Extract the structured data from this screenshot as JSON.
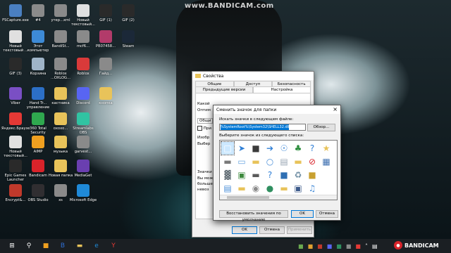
{
  "watermark": "www.BANDICAM.com",
  "desktop_icons": [
    {
      "label": "FSCapture.exe",
      "icon": "app-icon",
      "color": "#4a7fc1"
    },
    {
      "label": "#4",
      "icon": "file-icon",
      "color": "#8a8a8a"
    },
    {
      "label": "утер...xml",
      "icon": "file-icon",
      "color": "#8a8a8a"
    },
    {
      "label": "Новый текстовый...",
      "icon": "text-file-icon",
      "color": "#e0e0e0"
    },
    {
      "label": "GIF (1)",
      "icon": "image-icon",
      "color": "#2a2a2a"
    },
    {
      "label": "GIF (2)",
      "icon": "image-icon",
      "color": "#2a2a2a"
    },
    {
      "label": "Новый текстовый ...",
      "icon": "text-file-icon",
      "color": "#e0e0e0"
    },
    {
      "label": "Этот компьютер",
      "icon": "computer-icon",
      "color": "#3d8ad6"
    },
    {
      "label": "BandiSt...",
      "icon": "file-icon",
      "color": "#8a8a8a"
    },
    {
      "label": "mcf6...",
      "icon": "file-icon",
      "color": "#8a8a8a"
    },
    {
      "label": "PB07458...",
      "icon": "image-icon",
      "color": "#b23b6a"
    },
    {
      "label": "Steam",
      "icon": "steam-icon",
      "color": "#1b2838"
    },
    {
      "label": "GIF (3)",
      "icon": "image-icon",
      "color": "#2a2a2a"
    },
    {
      "label": "Корзина",
      "icon": "recycle-bin-icon",
      "color": "#9fb4c8"
    },
    {
      "label": "Roblox ...OXLOG...",
      "icon": "file-icon",
      "color": "#8a8a8a"
    },
    {
      "label": "Roblox",
      "icon": "roblox-icon",
      "color": "#d93a3a"
    },
    {
      "label": "Гайд...",
      "icon": "file-icon",
      "color": "#8a8a8a"
    },
    {
      "label": "Viber",
      "icon": "viber-icon",
      "color": "#7a4fc4"
    },
    {
      "label": "Hand Tr... управление",
      "icon": "app-icon",
      "color": "#2c6fc6"
    },
    {
      "label": "кастника",
      "icon": "folder-icon",
      "color": "#e8c35a"
    },
    {
      "label": "Discord",
      "icon": "discord-icon",
      "color": "#5865f2"
    },
    {
      "label": "кнопка",
      "icon": "folder-icon",
      "color": "#e8c35a"
    },
    {
      "label": "Яндекс.Браузер",
      "icon": "yandex-icon",
      "color": "#e53935"
    },
    {
      "label": "360 Total Security",
      "icon": "shield-icon",
      "color": "#2fa84f"
    },
    {
      "label": "охохо...",
      "icon": "folder-icon",
      "color": "#e8c35a"
    },
    {
      "label": "Streamlabs OBS",
      "icon": "obs-icon",
      "color": "#31c3a2"
    },
    {
      "label": "Новый текстовый...",
      "icon": "text-file-icon",
      "color": "#e0e0e0"
    },
    {
      "label": "AIMP",
      "icon": "aimp-icon",
      "color": "#f0a020"
    },
    {
      "label": "музыка",
      "icon": "folder-icon",
      "color": "#e8c35a"
    },
    {
      "label": "garvest...",
      "icon": "file-icon",
      "color": "#8a8a8a"
    },
    {
      "label": "Epic Games Launcher",
      "icon": "epic-icon",
      "color": "#2a2a2a"
    },
    {
      "label": "Bandicam",
      "icon": "bandicam-icon",
      "color": "#d8232a"
    },
    {
      "label": "Новая папка",
      "icon": "folder-icon",
      "color": "#e8c35a"
    },
    {
      "label": "MediaGet",
      "icon": "mediaget-icon",
      "color": "#6a3fb0"
    },
    {
      "label": "Encrypt&...",
      "icon": "app-icon",
      "color": "#c0392b"
    },
    {
      "label": "OBS Studio",
      "icon": "obs-icon",
      "color": "#302e31"
    },
    {
      "label": "xs",
      "icon": "file-icon",
      "color": "#8a8a8a"
    },
    {
      "label": "Microsoft Edge",
      "icon": "edge-icon",
      "color": "#1f8ad8"
    }
  ],
  "properties": {
    "title": "Свойства",
    "tabs_row1": [
      "Общие",
      "Доступ",
      "Безопасность"
    ],
    "tabs_row2": [
      "Предыдущие версии",
      "Настройка"
    ],
    "active_tab": "Настройка",
    "text1": "Какой",
    "text2": "Оптим",
    "text3": "Общи",
    "text4": "При",
    "text5": "Изобр",
    "text6": "Выбер",
    "text7": "Значки",
    "text8": "Вы можете",
    "text9": "больше",
    "text10": "невоз",
    "ok": "OK",
    "cancel": "Отмена",
    "apply": "Применить"
  },
  "change_icon": {
    "title": "Сменить значок для папки",
    "search_label": "Искать значки в следующем файле:",
    "path": "%SystemRoot%\\System32\\SHELL32.dll",
    "browse": "Обзор...",
    "choose_label": "Выберите значок из следующего списка:",
    "restore": "Восстановить значения по умолчанию",
    "ok": "OK",
    "cancel": "Отмена",
    "icons": [
      {
        "name": "blank-page-icon",
        "glyph": "□",
        "color": "#ffffff"
      },
      {
        "name": "drive-icon",
        "glyph": "▬",
        "color": "#7a7a7a"
      },
      {
        "name": "printer-icon",
        "glyph": "▓",
        "color": "#5f6b73"
      },
      {
        "name": "document-icon",
        "glyph": "▤",
        "color": "#4a8fd8"
      },
      {
        "name": "arrow-icon",
        "glyph": "➤",
        "color": "#2f7fd6"
      },
      {
        "name": "window-icon",
        "glyph": "▭",
        "color": "#6aa5e0"
      },
      {
        "name": "chip-icon",
        "glyph": "▣",
        "color": "#3d8a3d"
      },
      {
        "name": "folder-icon",
        "glyph": "▬",
        "color": "#e8c35a"
      },
      {
        "name": "floppy-icon",
        "glyph": "■",
        "color": "#3a3a3a"
      },
      {
        "name": "folder-search-icon",
        "glyph": "▬",
        "color": "#e8c35a"
      },
      {
        "name": "network-drive-icon",
        "glyph": "▬",
        "color": "#5a5a5a"
      },
      {
        "name": "cd-drive-icon",
        "glyph": "◉",
        "color": "#8a8a8a"
      },
      {
        "name": "arrow-right-icon",
        "glyph": "➔",
        "color": "#2f7fd6"
      },
      {
        "name": "magnifier-icon",
        "glyph": "○",
        "color": "#4a8fd8"
      },
      {
        "name": "help-icon",
        "glyph": "?",
        "color": "#2f7fd6"
      },
      {
        "name": "globe-icon",
        "glyph": "●",
        "color": "#2f8f5f"
      },
      {
        "name": "search-icon",
        "glyph": "☉",
        "color": "#4a8fd8"
      },
      {
        "name": "document-2-icon",
        "glyph": "▤",
        "color": "#9aa7b4"
      },
      {
        "name": "computer-icon",
        "glyph": "■",
        "color": "#2f6fb3"
      },
      {
        "name": "folder-tree-icon",
        "glyph": "▬",
        "color": "#e8c35a"
      },
      {
        "name": "tree-icon",
        "glyph": "♣",
        "color": "#2f8f3f"
      },
      {
        "name": "folder-2-icon",
        "glyph": "▬",
        "color": "#e8c35a"
      },
      {
        "name": "recycle-bin-icon",
        "glyph": "♻",
        "color": "#6a8aa0"
      },
      {
        "name": "monitor-icon",
        "glyph": "▣",
        "color": "#3c5a8a"
      },
      {
        "name": "help-circle-icon",
        "glyph": "?",
        "color": "#2f7fd6"
      },
      {
        "name": "no-entry-icon",
        "glyph": "⊘",
        "color": "#d8232a"
      },
      {
        "name": "lock-icon",
        "glyph": "■",
        "color": "#c8a030"
      },
      {
        "name": "music-icon",
        "glyph": "♫",
        "color": "#4a8fd8"
      },
      {
        "name": "star-icon",
        "glyph": "★",
        "color": "#e8c35a"
      },
      {
        "name": "grid-icon",
        "glyph": "▦",
        "color": "#3d6fb0"
      }
    ]
  },
  "taskbar": {
    "items": [
      {
        "name": "start-icon",
        "glyph": "⊞",
        "color": "#ffffff"
      },
      {
        "name": "search-icon",
        "glyph": "⚲",
        "color": "#ffffff"
      },
      {
        "name": "task-app-icon",
        "glyph": "■",
        "color": "#f0a020"
      },
      {
        "name": "task-browser-icon",
        "glyph": "B",
        "color": "#2f6fd6"
      },
      {
        "name": "task-explorer-icon",
        "glyph": "▬",
        "color": "#e8c35a"
      },
      {
        "name": "task-edge-icon",
        "glyph": "e",
        "color": "#1f8ad8"
      },
      {
        "name": "task-yandex-icon",
        "glyph": "Y",
        "color": "#e53935"
      }
    ],
    "tray": [
      {
        "name": "tray-app1-icon",
        "glyph": "■",
        "color": "#6aa84f"
      },
      {
        "name": "tray-app2-icon",
        "glyph": "■",
        "color": "#e0a030"
      },
      {
        "name": "tray-app3-icon",
        "glyph": "■",
        "color": "#c0392b"
      },
      {
        "name": "tray-app4-icon",
        "glyph": "■",
        "color": "#5865f2"
      },
      {
        "name": "tray-app5-icon",
        "glyph": "■",
        "color": "#2f8f5f"
      },
      {
        "name": "tray-app6-icon",
        "glyph": "■",
        "color": "#8a8a8a"
      },
      {
        "name": "tray-app7-icon",
        "glyph": "■",
        "color": "#e53935"
      },
      {
        "name": "tray-chevron-icon",
        "glyph": "˄",
        "color": "#ffffff"
      },
      {
        "name": "tray-network-icon",
        "glyph": "▤",
        "color": "#ffffff"
      }
    ],
    "bandicam_label": "BANDICAM"
  }
}
